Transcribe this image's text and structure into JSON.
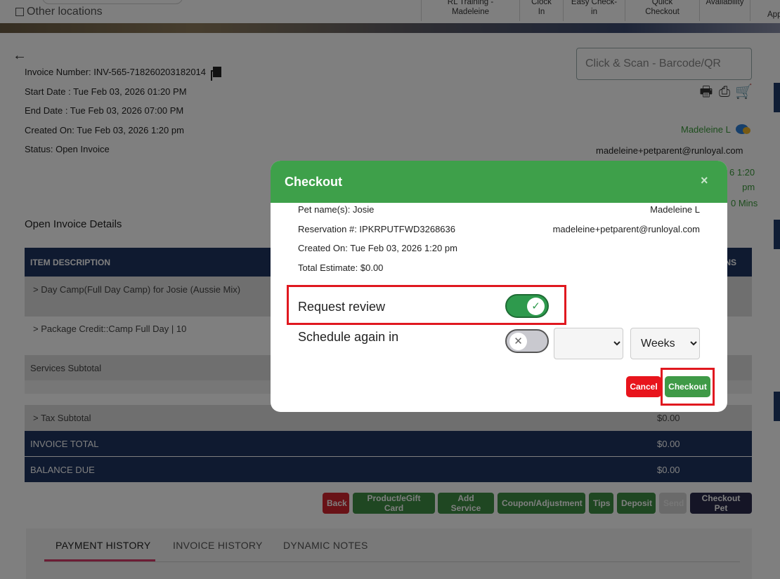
{
  "topnav": {
    "other_locations": "Other locations",
    "items": [
      {
        "line1": "RL Training -",
        "line2": "Madeleine"
      },
      {
        "line1": "Clock",
        "line2": "In"
      },
      {
        "line1": "Easy Check-",
        "line2": "in"
      },
      {
        "line1": "Quick",
        "line2": "Checkout"
      },
      {
        "line1": "Availability",
        "line2": ""
      },
      {
        "line1": "",
        "line2": "App"
      }
    ]
  },
  "invoice": {
    "number_label": "Invoice Number: INV-565-718260203182014",
    "start_date": "Start Date : Tue Feb 03, 2026 01:20 PM",
    "end_date": "End Date : Tue Feb 03, 2026 07:00 PM",
    "created_on": "Created On: Tue Feb 03, 2026 1:20 pm",
    "status": "Status: Open Invoice"
  },
  "scan": {
    "placeholder": "Click & Scan - Barcode/QR"
  },
  "customer": {
    "name": "Madeleine L",
    "email": "madeleine+petparent@runloyal.com",
    "peek_time_1": "6 1:20",
    "peek_time_2": "pm",
    "peek_mins": "0 Mins"
  },
  "details": {
    "title": "Open Invoice Details",
    "col_item": "ITEM DESCRIPTION",
    "col_right": "NS",
    "rows": [
      {
        "label": ">   Day Camp(Full Day Camp) for Josie (Aussie Mix)"
      },
      {
        "label": ">   Package Credit::Camp Full Day | 10"
      },
      {
        "label": "Services Subtotal"
      },
      {
        "label": ">   Tax Subtotal",
        "value": "$0.00"
      },
      {
        "label": "INVOICE TOTAL",
        "value": "$0.00"
      },
      {
        "label": "BALANCE DUE",
        "value": "$0.00"
      }
    ]
  },
  "actions": {
    "back": "Back",
    "product": "Product/eGift Card",
    "add_service": "Add Service",
    "coupon": "Coupon/Adjustment",
    "tips": "Tips",
    "deposit": "Deposit",
    "send": "Send",
    "checkout_pet": "Checkout Pet"
  },
  "tabs": [
    "PAYMENT HISTORY",
    "INVOICE HISTORY",
    "DYNAMIC NOTES"
  ],
  "modal": {
    "title": "Checkout",
    "close": "×",
    "pet_names": "Pet name(s): Josie",
    "reservation": "Reservation #: IPKRPUTFWD3268636",
    "created_on": "Created On: Tue Feb 03, 2026 1:20 pm",
    "total_estimate": "Total Estimate: $0.00",
    "customer_name": "Madeleine L",
    "customer_email": "madeleine+petparent@runloyal.com",
    "request_review_label": "Request review",
    "request_review_on": true,
    "schedule_label": "Schedule again in",
    "schedule_on": false,
    "schedule_amount": "",
    "schedule_unit": "Weeks",
    "cancel": "Cancel",
    "checkout": "Checkout"
  },
  "colors": {
    "modal_header": "#3ea04a",
    "navy": "#1e3460",
    "highlight": "#e0181f",
    "cancel_red": "#e8141c",
    "checkout_green": "#3f9a47"
  }
}
